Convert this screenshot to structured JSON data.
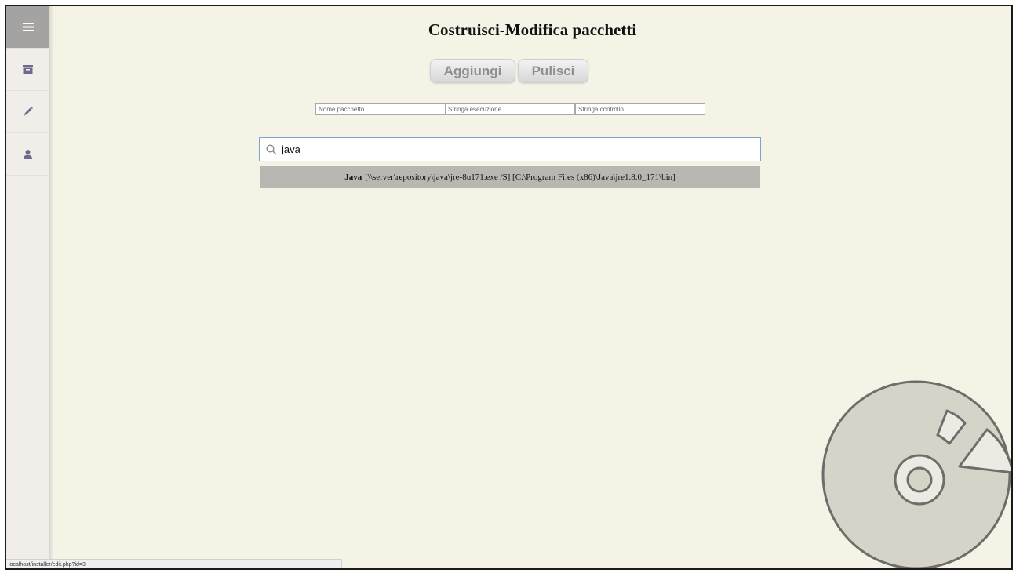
{
  "page": {
    "title": "Costruisci-Modifica pacchetti"
  },
  "sidebar": {
    "items": [
      {
        "icon": "menu-icon"
      },
      {
        "icon": "archive-icon"
      },
      {
        "icon": "pencil-icon"
      },
      {
        "icon": "user-icon"
      }
    ]
  },
  "toolbar": {
    "add_label": "Aggiungi",
    "clear_label": "Pulisci"
  },
  "form": {
    "package_name_placeholder": "Nome pacchetto",
    "exec_string_placeholder": "Stringa esecuzione",
    "check_string_placeholder": "Stringa controllo"
  },
  "search": {
    "value": "java",
    "icon": "search-icon"
  },
  "results": [
    {
      "name": "Java",
      "detail": "[\\\\server\\repository\\java\\jre-8u171.exe /S] [C:\\Program Files (x86)\\Java\\jre1.8.0_171\\bin]"
    }
  ],
  "status_bar": {
    "url": "localhost/installer/edit.php?id=3"
  },
  "colors": {
    "background": "#f5f3e6",
    "sidebar": "#f1eeea",
    "sidebar_active": "#a5a3a1",
    "icon": "#6e6a8e",
    "result_bg": "#b9b7b2",
    "disc": "#d6d4c8"
  }
}
